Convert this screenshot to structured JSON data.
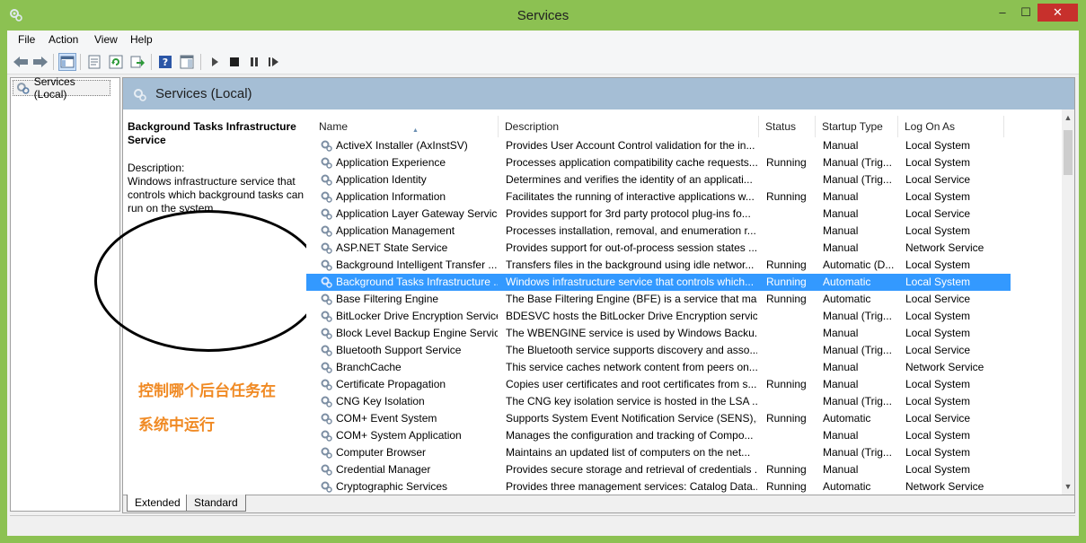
{
  "window": {
    "title": "Services",
    "controls": {
      "minimize": "–",
      "maximize": "☐",
      "close": "✕"
    }
  },
  "menu": [
    "File",
    "Action",
    "View",
    "Help"
  ],
  "toolbar": {
    "icons": [
      "back-icon",
      "forward-icon",
      "show-hide-console-tree-icon",
      "properties-icon",
      "refresh-icon",
      "export-list-icon",
      "help-icon",
      "show-action-pane-icon",
      "start-service-icon",
      "stop-service-icon",
      "pause-service-icon",
      "restart-service-icon"
    ]
  },
  "tree": {
    "item": "Services (Local)"
  },
  "main": {
    "header": "Services (Local)",
    "selected_title": "Background Tasks Infrastructure Service",
    "description_label": "Description:",
    "description_text": "Windows infrastructure service that controls which background tasks can run on the system.",
    "annotation_line1": "控制哪个后台任务在",
    "annotation_line2": "系统中运行"
  },
  "columns": [
    "Name",
    "Description",
    "Status",
    "Startup Type",
    "Log On As"
  ],
  "rows": [
    [
      "ActiveX Installer (AxInstSV)",
      "Provides User Account Control validation for the in...",
      "",
      "Manual",
      "Local System"
    ],
    [
      "Application Experience",
      "Processes application compatibility cache requests...",
      "Running",
      "Manual (Trig...",
      "Local System"
    ],
    [
      "Application Identity",
      "Determines and verifies the identity of an applicati...",
      "",
      "Manual (Trig...",
      "Local Service"
    ],
    [
      "Application Information",
      "Facilitates the running of interactive applications w...",
      "Running",
      "Manual",
      "Local System"
    ],
    [
      "Application Layer Gateway Service",
      "Provides support for 3rd party protocol plug-ins fo...",
      "",
      "Manual",
      "Local Service"
    ],
    [
      "Application Management",
      "Processes installation, removal, and enumeration r...",
      "",
      "Manual",
      "Local System"
    ],
    [
      "ASP.NET State Service",
      "Provides support for out-of-process session states ...",
      "",
      "Manual",
      "Network Service"
    ],
    [
      "Background Intelligent Transfer ...",
      "Transfers files in the background using idle networ...",
      "Running",
      "Automatic (D...",
      "Local System"
    ],
    [
      "Background Tasks Infrastructure ...",
      "Windows infrastructure service that controls which...",
      "Running",
      "Automatic",
      "Local System"
    ],
    [
      "Base Filtering Engine",
      "The Base Filtering Engine (BFE) is a service that ma...",
      "Running",
      "Automatic",
      "Local Service"
    ],
    [
      "BitLocker Drive Encryption Service",
      "BDESVC hosts the BitLocker Drive Encryption servic...",
      "",
      "Manual (Trig...",
      "Local System"
    ],
    [
      "Block Level Backup Engine Service",
      "The WBENGINE service is used by Windows Backu...",
      "",
      "Manual",
      "Local System"
    ],
    [
      "Bluetooth Support Service",
      "The Bluetooth service supports discovery and asso...",
      "",
      "Manual (Trig...",
      "Local Service"
    ],
    [
      "BranchCache",
      "This service caches network content from peers on...",
      "",
      "Manual",
      "Network Service"
    ],
    [
      "Certificate Propagation",
      "Copies user certificates and root certificates from s...",
      "Running",
      "Manual",
      "Local System"
    ],
    [
      "CNG Key Isolation",
      "The CNG key isolation service is hosted in the LSA ...",
      "",
      "Manual (Trig...",
      "Local System"
    ],
    [
      "COM+ Event System",
      "Supports System Event Notification Service (SENS),...",
      "Running",
      "Automatic",
      "Local Service"
    ],
    [
      "COM+ System Application",
      "Manages the configuration and tracking of Compo...",
      "",
      "Manual",
      "Local System"
    ],
    [
      "Computer Browser",
      "Maintains an updated list of computers on the net...",
      "",
      "Manual (Trig...",
      "Local System"
    ],
    [
      "Credential Manager",
      "Provides secure storage and retrieval of credentials ...",
      "Running",
      "Manual",
      "Local System"
    ],
    [
      "Cryptographic Services",
      "Provides three management services: Catalog Data...",
      "Running",
      "Automatic",
      "Network Service"
    ]
  ],
  "selected_row": 8,
  "tabs": [
    "Extended",
    "Standard"
  ]
}
